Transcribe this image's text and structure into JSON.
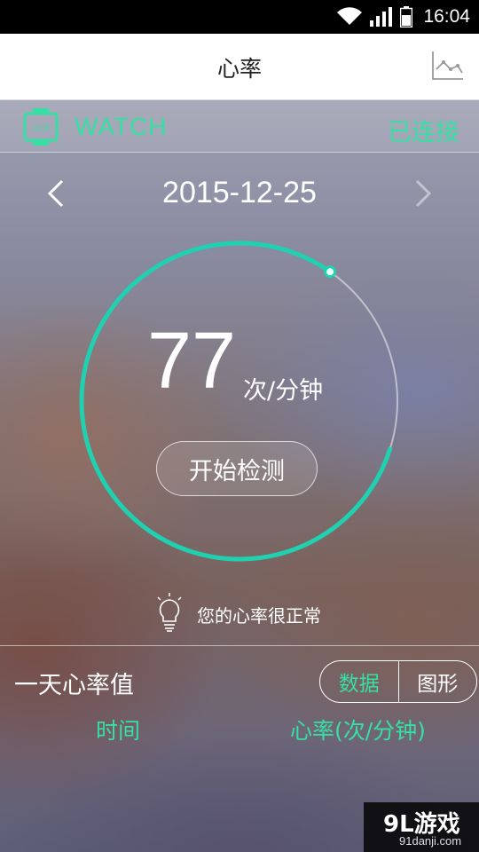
{
  "status_bar": {
    "time": "16:04"
  },
  "app_bar": {
    "title": "心率"
  },
  "device": {
    "name": "WATCH",
    "connection_status": "已连接",
    "icon_text": "11:09"
  },
  "date_nav": {
    "date": "2015-12-25"
  },
  "measurement": {
    "value": "77",
    "unit": "次/分钟",
    "start_button_label": "开始检测",
    "progress_fraction": 0.2
  },
  "tip": {
    "text": "您的心率很正常"
  },
  "daily": {
    "title": "一天心率值",
    "toggle": {
      "options": [
        "数据",
        "图形"
      ],
      "selected": "数据"
    },
    "columns": [
      "时间",
      "心率(次/分钟)"
    ]
  },
  "watermark": {
    "brand": "9L游戏",
    "url": "91danji.com"
  },
  "colors": {
    "accent": "#36e0a4",
    "ring": "#1fd1b0"
  }
}
